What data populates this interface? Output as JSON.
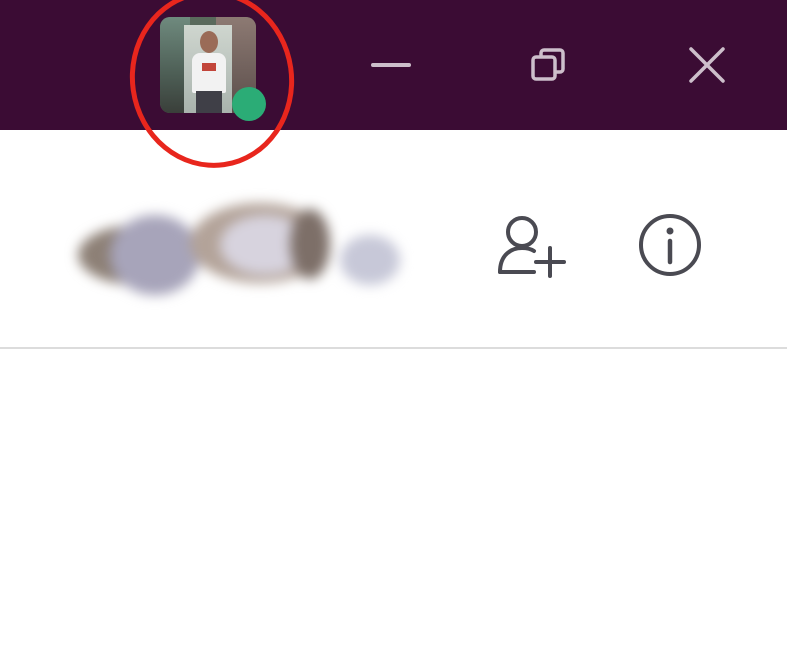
{
  "window": {
    "background_color": "#3b0c34",
    "controls": {
      "minimize_icon": "minimize-icon",
      "restore_icon": "restore-icon",
      "close_icon": "close-icon"
    }
  },
  "user": {
    "avatar_icon": "avatar",
    "presence": "active",
    "presence_color": "#2bac76"
  },
  "annotation": {
    "highlight_color": "#e8261d"
  },
  "header": {
    "name_blurred": true,
    "actions": {
      "add_user_icon": "add-user-icon",
      "info_icon": "info-icon"
    }
  }
}
